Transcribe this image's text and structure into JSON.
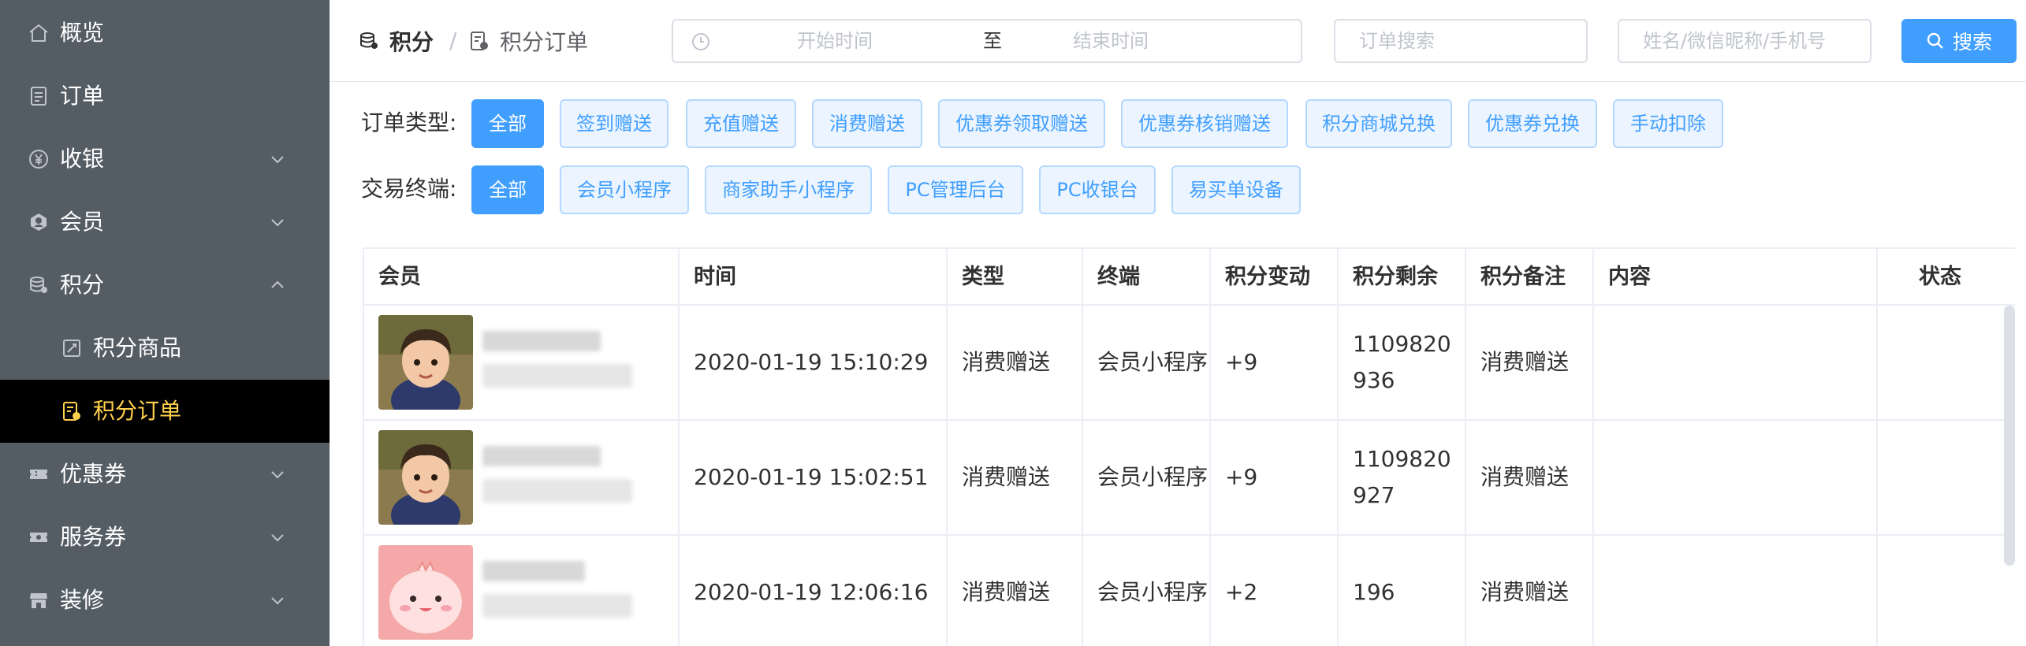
{
  "sidebar": {
    "items": [
      {
        "label": "概览",
        "icon": "home-icon"
      },
      {
        "label": "订单",
        "icon": "order-icon"
      },
      {
        "label": "收银",
        "icon": "yen-icon",
        "expandable": true
      },
      {
        "label": "会员",
        "icon": "member-icon",
        "expandable": true
      },
      {
        "label": "积分",
        "icon": "points-icon",
        "expanded": true
      },
      {
        "label": "积分商品",
        "icon": "points-goods-icon",
        "sub": true
      },
      {
        "label": "积分订单",
        "icon": "points-order-icon",
        "sub": true,
        "active": true
      },
      {
        "label": "优惠券",
        "icon": "coupon-icon",
        "expandable": true
      },
      {
        "label": "服务券",
        "icon": "service-ticket-icon",
        "expandable": true
      },
      {
        "label": "装修",
        "icon": "shop-decor-icon",
        "expandable": true
      }
    ]
  },
  "breadcrumb": {
    "level1": "积分",
    "level2": "积分订单"
  },
  "search": {
    "start_placeholder": "开始时间",
    "range_separator": "至",
    "end_placeholder": "结束时间",
    "order_placeholder": "订单搜索",
    "member_placeholder": "姓名/微信昵称/手机号",
    "button_label": "搜索"
  },
  "filters": {
    "order_type_label": "订单类型:",
    "order_types": [
      "全部",
      "签到赠送",
      "充值赠送",
      "消费赠送",
      "优惠券领取赠送",
      "优惠券核销赠送",
      "积分商城兑换",
      "优惠券兑换",
      "手动扣除"
    ],
    "order_type_selected": "全部",
    "terminal_label": "交易终端:",
    "terminals": [
      "全部",
      "会员小程序",
      "商家助手小程序",
      "PC管理后台",
      "PC收银台",
      "易买单设备"
    ],
    "terminal_selected": "全部"
  },
  "table": {
    "columns": [
      "会员",
      "时间",
      "类型",
      "终端",
      "积分变动",
      "积分剩余",
      "积分备注",
      "内容",
      "状态"
    ],
    "rows": [
      {
        "time": "2020-01-19 15:10:29",
        "type": "消费赠送",
        "terminal": "会员小程序",
        "change": "+9",
        "balance": "1109820936",
        "note": "消费赠送",
        "content": "",
        "status": "",
        "avatar": "child-photo"
      },
      {
        "time": "2020-01-19 15:02:51",
        "type": "消费赠送",
        "terminal": "会员小程序",
        "change": "+9",
        "balance": "1109820927",
        "note": "消费赠送",
        "content": "",
        "status": "",
        "avatar": "child-photo"
      },
      {
        "time": "2020-01-19 12:06:16",
        "type": "消费赠送",
        "terminal": "会员小程序",
        "change": "+2",
        "balance": "196",
        "note": "消费赠送",
        "content": "",
        "status": "",
        "avatar": "pink-cartoon"
      }
    ]
  },
  "colors": {
    "sidebar_bg": "#545c64",
    "sidebar_active_bg": "#000000",
    "sidebar_active_text": "#ffd04b",
    "primary": "#409eff",
    "chip_bg": "#ecf5ff",
    "chip_border": "#b3d8ff"
  }
}
